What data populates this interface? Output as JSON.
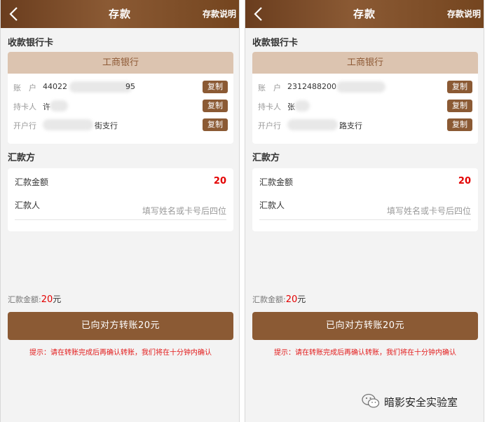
{
  "panels": [
    {
      "header": {
        "title": "存款",
        "help_link": "存款说明"
      },
      "bank_section_title": "收款银行卡",
      "bank": {
        "name": "工商银行",
        "rows": [
          {
            "label": "账　户",
            "value": "44022",
            "tail": "95",
            "copy_label": "复制"
          },
          {
            "label": "持卡人",
            "value": "许",
            "tail": "",
            "copy_label": "复制"
          },
          {
            "label": "开户行",
            "value": "",
            "tail": "街支行",
            "copy_label": "复制"
          }
        ]
      },
      "payer_section_title": "汇款方",
      "payer": {
        "amount_label": "汇款金额",
        "amount": "20",
        "name_label": "汇款人",
        "name_placeholder": "填写姓名或卡号后四位"
      },
      "summary": {
        "label": "汇款金额:",
        "amount": "20",
        "unit": "元"
      },
      "submit_label": "已向对方转账20元",
      "tip": "提示：请在转账完成后再确认转账，我们将在十分钟内确认"
    },
    {
      "header": {
        "title": "存款",
        "help_link": "存款说明"
      },
      "bank_section_title": "收款银行卡",
      "bank": {
        "name": "工商银行",
        "rows": [
          {
            "label": "账　户",
            "value": "2312488200",
            "tail": "",
            "copy_label": "复制"
          },
          {
            "label": "持卡人",
            "value": "张",
            "tail": "",
            "copy_label": "复制"
          },
          {
            "label": "开户行",
            "value": "",
            "tail": "路支行",
            "copy_label": "复制"
          }
        ]
      },
      "payer_section_title": "汇款方",
      "payer": {
        "amount_label": "汇款金额",
        "amount": "20",
        "name_label": "汇款人",
        "name_placeholder": "填写姓名或卡号后四位"
      },
      "summary": {
        "label": "汇款金额:",
        "amount": "20",
        "unit": "元"
      },
      "submit_label": "已向对方转账20元",
      "tip": "提示：请在转账完成后再确认转账，我们将在十分钟内确认"
    }
  ],
  "watermark": {
    "text": "暗影安全实验室",
    "icon": "wechat-icon"
  },
  "colors": {
    "header_brown": "#7a4a26",
    "button_brown": "#8b5a34",
    "bank_band": "#dcc4b0",
    "amount_red": "#e30000"
  }
}
